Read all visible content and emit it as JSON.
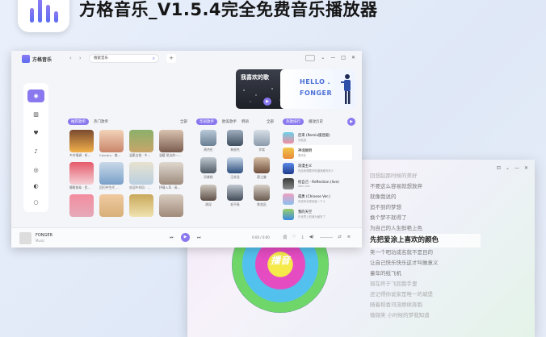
{
  "banner": {
    "title": "方格音乐_V1.5.4完全免费音乐播放器"
  },
  "main_window": {
    "brand": "方格音乐",
    "search_value": "搜索音乐",
    "nav_back": "‹",
    "nav_forward": "›",
    "plus": "+",
    "controls": [
      "⌄",
      "—",
      "□",
      "✕"
    ],
    "rail_icons": [
      "disc-icon",
      "chart-icon",
      "heart-icon",
      "note-icon",
      "radio-icon",
      "toggle-icon",
      "cloud-icon"
    ],
    "fav_card_title": "我喜欢的歌",
    "hello_line1": "HELLO .",
    "hello_line2": "FONGER",
    "playlist_panel": {
      "tabs": [
        "推荐歌单",
        "热门歌单"
      ],
      "more": "全部",
      "items": [
        {
          "cap": "乡村情调 · 听..."
        },
        {
          "cap": "Country · 美..."
        },
        {
          "cap": "温柔吉他 · 乡..."
        },
        {
          "cap": "温暖·思念的一..."
        },
        {
          "cap": "睡眠前辈 · 民..."
        },
        {
          "cap": "回归中生代 ..."
        },
        {
          "cap": "欢迎乡村风 · ..."
        },
        {
          "cap": "抒情入耳 · 高..."
        },
        {
          "cap": ""
        },
        {
          "cap": ""
        },
        {
          "cap": ""
        },
        {
          "cap": ""
        }
      ]
    },
    "artist_panel": {
      "tabs": [
        "华语歌手",
        "欧美歌手",
        "韩语"
      ],
      "more": "全部",
      "items": [
        {
          "cap": "周杰伦"
        },
        {
          "cap": "林俊杰"
        },
        {
          "cap": "许嵩"
        },
        {
          "cap": "邓紫棋"
        },
        {
          "cap": "汪苏泷"
        },
        {
          "cap": "薛之谦"
        },
        {
          "cap": "周深"
        },
        {
          "cap": "毛不易"
        },
        {
          "cap": "陈奕迅"
        }
      ]
    },
    "chart_panel": {
      "tabs": [
        "热歌排行",
        "播放历史"
      ],
      "songs": [
        {
          "title": "后来 (Remix版混版)",
          "sub": "刘若英"
        },
        {
          "title": "神魂颠倒",
          "sub": "周杰伦"
        },
        {
          "title": "浪漫主义",
          "sub": "在此我想要你知道我爱你多少"
        },
        {
          "title": "给自己 - Reflection (live)",
          "sub": "Sam Lee"
        },
        {
          "title": "孤勇 (Chinese Ver.)",
          "sub": "你说你也是孤独一个人"
        },
        {
          "title": "我的天空",
          "sub": "在世界上知道为最好了"
        }
      ]
    },
    "player": {
      "title": "FONGER",
      "subtitle": "Music",
      "prev": "⏮",
      "play": "▶",
      "next": "⏭",
      "time": "0:00 / 0:00",
      "icons": [
        "lyric-icon",
        "like-icon",
        "download-icon",
        "volume-icon",
        "mode-icon",
        "list-icon"
      ]
    }
  },
  "lyric_window": {
    "disc_label": "播音",
    "controls": [
      "⊡",
      "⌄",
      "—",
      "✕"
    ],
    "lines": [
      {
        "text": "回想起那时候的美好",
        "state": "faded"
      },
      {
        "text": "不要这么容易就想放弃",
        "state": "normal"
      },
      {
        "text": "就像我说的",
        "state": "normal"
      },
      {
        "text": "追不到的梦想",
        "state": "normal"
      },
      {
        "text": "换个梦不就得了",
        "state": "normal"
      },
      {
        "text": "为自己的人生鲜艳上色",
        "state": "normal"
      },
      {
        "text": "先把爱涂上喜欢的颜色",
        "state": "active"
      },
      {
        "text": "笑一个吧功成名就不是目的",
        "state": "normal"
      },
      {
        "text": "让自己快乐快乐这才叫做意义",
        "state": "normal"
      },
      {
        "text": "童年的纸飞机",
        "state": "normal"
      },
      {
        "text": "现在终于飞回我手里",
        "state": "faded"
      },
      {
        "text": "还记得你说家是唯一的城堡",
        "state": "faded"
      },
      {
        "text": "随着稻香河流继续奔跑",
        "state": "faded"
      },
      {
        "text": "微微笑 小时候的梦我知道",
        "state": "faded"
      }
    ]
  },
  "colors": {
    "accent": "#8a78ef",
    "brand_blue": "#4b6fd6"
  }
}
